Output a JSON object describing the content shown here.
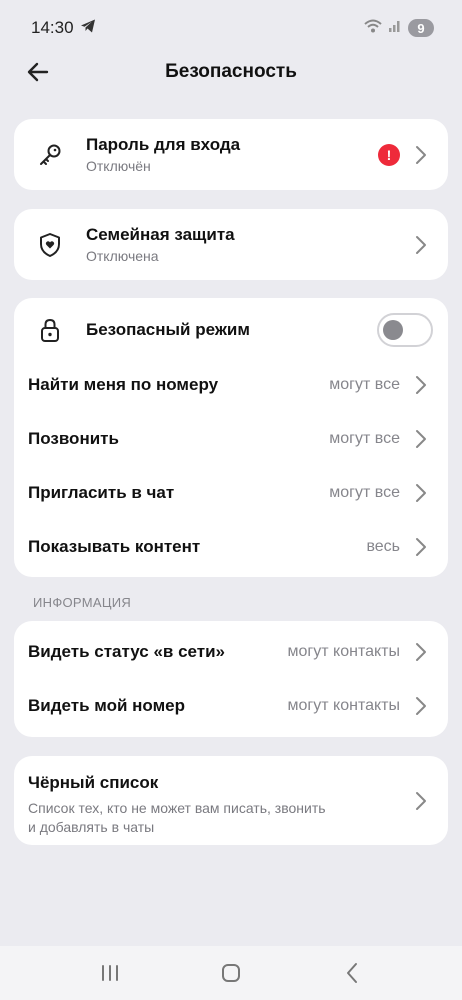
{
  "status": {
    "time": "14:30",
    "battery": "9"
  },
  "header": {
    "title": "Безопасность"
  },
  "login_password": {
    "title": "Пароль для входа",
    "subtitle": "Отключён",
    "alert": "!"
  },
  "family_protection": {
    "title": "Семейная защита",
    "subtitle": "Отключена"
  },
  "privacy": {
    "safe_mode": {
      "title": "Безопасный режим",
      "enabled": false
    },
    "rows": [
      {
        "label": "Найти меня по номеру",
        "value": "могут все"
      },
      {
        "label": "Позвонить",
        "value": "могут все"
      },
      {
        "label": "Пригласить в чат",
        "value": "могут все"
      },
      {
        "label": "Показывать контент",
        "value": "весь"
      }
    ]
  },
  "info": {
    "section_label": "ИНФОРМАЦИЯ",
    "rows": [
      {
        "label": "Видеть статус «в сети»",
        "value": "могут контакты"
      },
      {
        "label": "Видеть мой номер",
        "value": "могут контакты"
      }
    ]
  },
  "blacklist": {
    "title": "Чёрный список",
    "description_line1": "Список тех, кто не может вам писать, звонить",
    "description_line2": "и добавлять в чаты"
  },
  "colors": {
    "background": "#ebebf0",
    "card": "#ffffff",
    "alert": "#ee2a3a",
    "secondary_text": "#86868c"
  },
  "icons": [
    "telegram-icon",
    "wifi-icon",
    "signal-icon",
    "back-arrow-icon",
    "key-icon",
    "shield-heart-icon",
    "lock-icon",
    "chevron-right-icon",
    "recent-apps-icon",
    "home-icon",
    "back-nav-icon"
  ]
}
